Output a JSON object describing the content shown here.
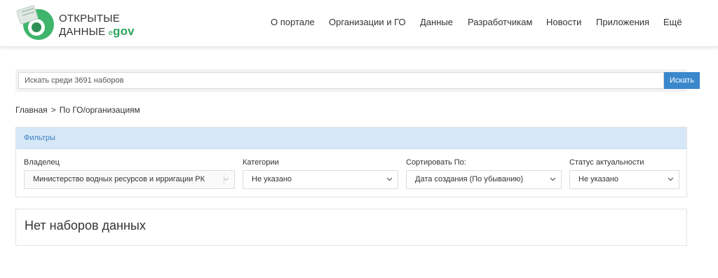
{
  "header": {
    "logo": {
      "line1": "ОТКРЫТЫЕ",
      "line2": "ДАННЫЕ",
      "e": "e",
      "gov": "gov"
    },
    "nav": [
      {
        "label": "О портале"
      },
      {
        "label": "Организации и ГО"
      },
      {
        "label": "Данные"
      },
      {
        "label": "Разработчикам"
      },
      {
        "label": "Новости"
      },
      {
        "label": "Приложения"
      },
      {
        "label": "Ещё"
      }
    ]
  },
  "search": {
    "placeholder": "Искать среди 3691 наборов",
    "button": "Искать"
  },
  "breadcrumb": {
    "home": "Главная",
    "separator": ">",
    "current": "По ГО/организациям"
  },
  "filters": {
    "title": "Фильтры",
    "owner": {
      "label": "Владелец",
      "value": "Министерство водных ресурсов и ирригации РК"
    },
    "categories": {
      "label": "Категории",
      "value": "Не указано"
    },
    "sort": {
      "label": "Сортировать По:",
      "value": "Дата создания (По убыванию)"
    },
    "status": {
      "label": "Статус актуальности",
      "value": "Не указано"
    }
  },
  "results": {
    "empty_message": "Нет наборов данных"
  },
  "colors": {
    "accent": "#3a87cc",
    "brand_green": "#2ba35c",
    "filter_header_bg": "#d6e8f7"
  }
}
